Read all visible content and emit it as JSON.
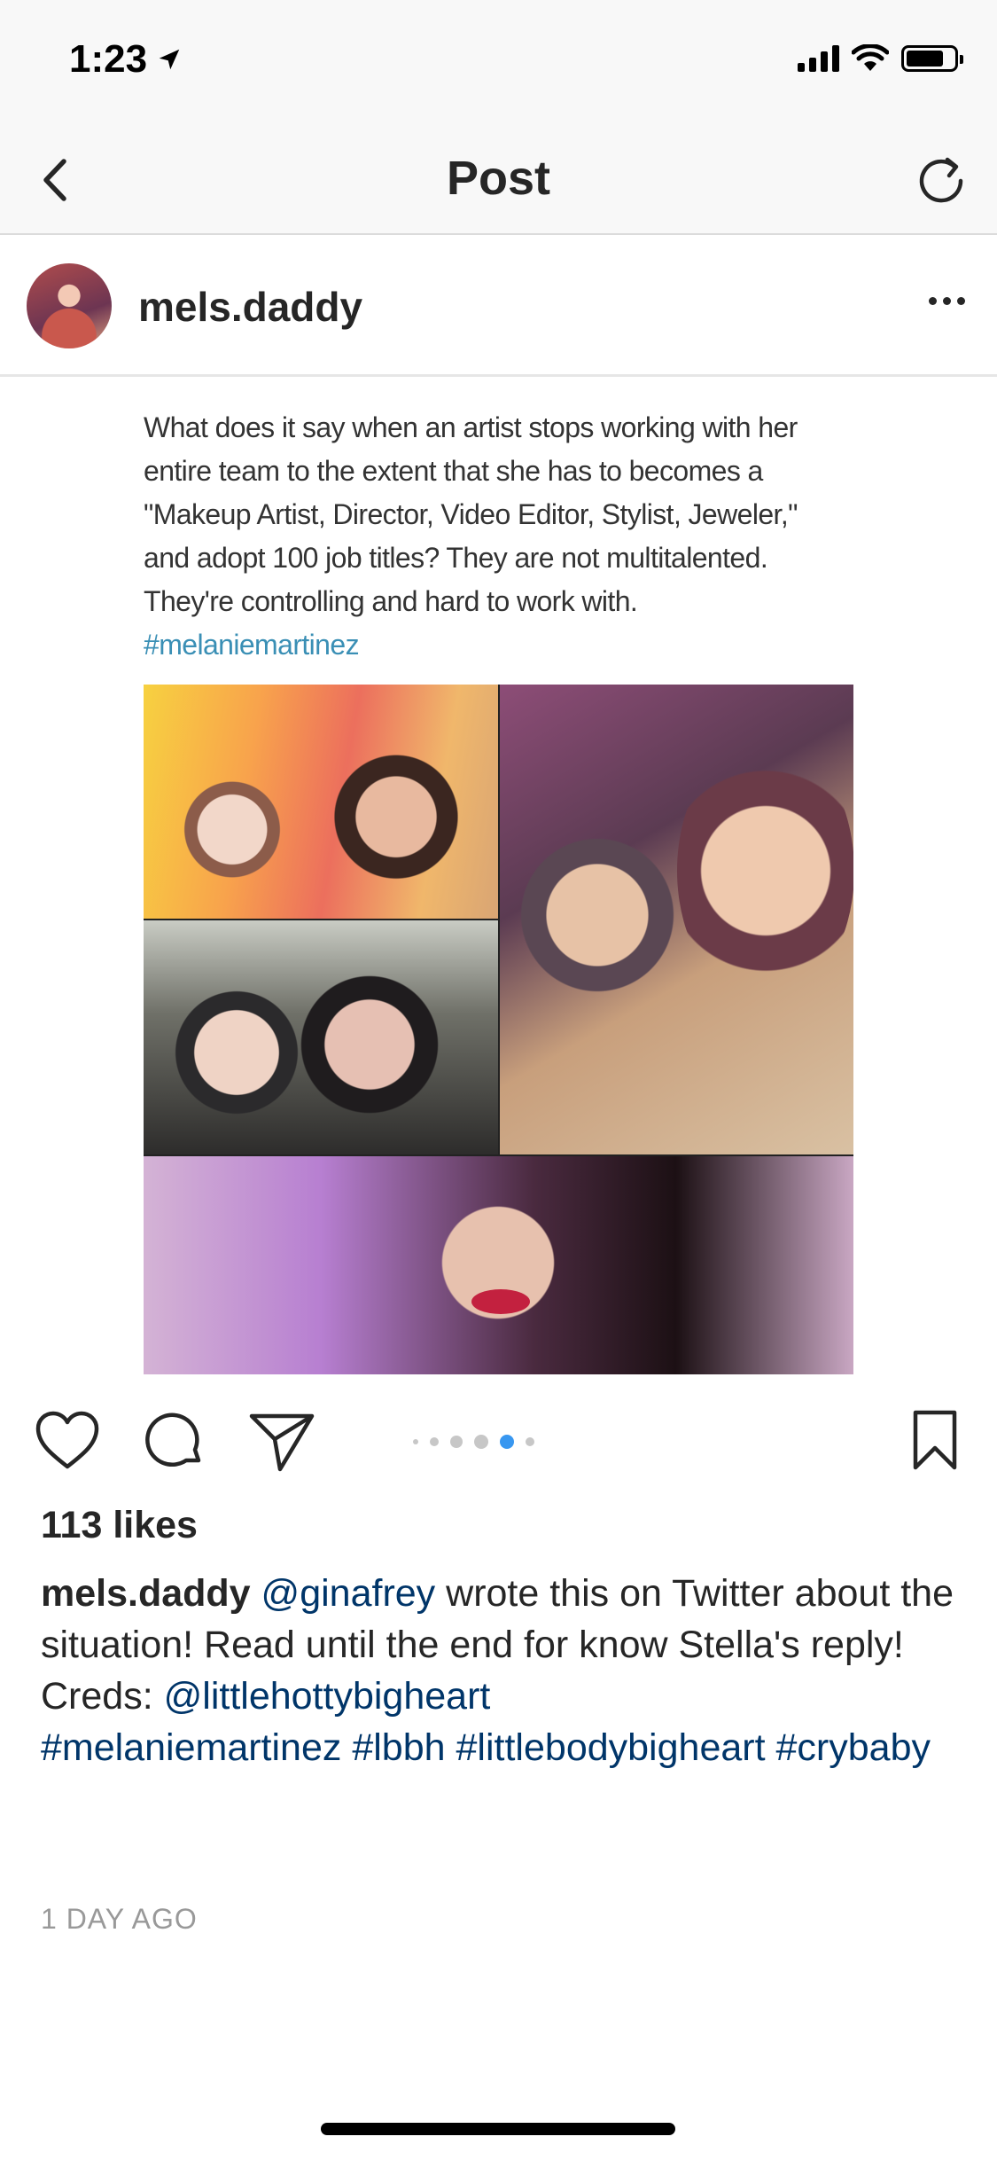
{
  "status_bar": {
    "time": "1:23",
    "icons": [
      "location-arrow-icon",
      "signal-icon",
      "wifi-icon",
      "battery-icon"
    ]
  },
  "nav": {
    "title": "Post",
    "back_icon": "chevron-left-icon",
    "refresh_icon": "refresh-icon"
  },
  "post": {
    "username": "mels.daddy",
    "more_icon": "more-horizontal-icon",
    "image": {
      "text_lines": [
        "What does it say when an artist stops working with her",
        "entire team to the extent that she has to becomes a",
        "\"Makeup Artist, Director, Video Editor, Stylist, Jeweler,\"",
        "and adopt 100 job titles? They are not multitalented.",
        "They're controlling and hard to work with."
      ],
      "hashtag": "#melaniemartinez"
    },
    "actions": {
      "like_icon": "heart-icon",
      "comment_icon": "comment-icon",
      "share_icon": "paper-plane-icon",
      "save_icon": "bookmark-icon"
    },
    "carousel": {
      "count": 6,
      "active_index": 4
    },
    "likes": "113 likes",
    "caption": {
      "username": "mels.daddy",
      "mention": "@ginafrey",
      "text_part1": " wrote this on Twitter about the situation! Read until the end for know Stella's reply!",
      "creds_label": "Creds: ",
      "creds_mention": "@littlehottybigheart",
      "hashtags": [
        "#melaniemartinez",
        "#lbbh",
        "#littlebodybigheart",
        "#crybaby"
      ]
    },
    "timestamp": "1 DAY AGO"
  },
  "colors": {
    "link": "#003569",
    "carousel_active": "#3897f0",
    "image_hashtag": "#3a8fb5"
  }
}
